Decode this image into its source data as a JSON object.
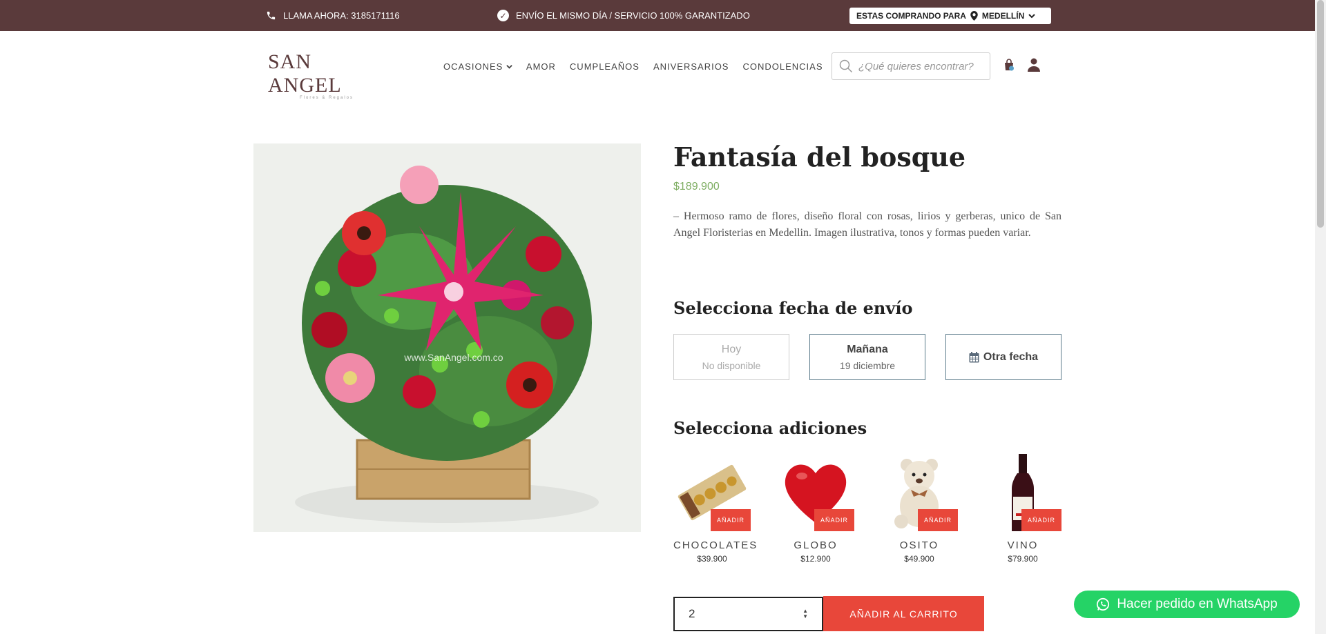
{
  "topbar": {
    "phone": "LLAMA AHORA: 3185171116",
    "guarantee": "ENVÍO EL MISMO DÍA / SERVICIO 100% GARANTIZADO",
    "buying_for": "ESTAS COMPRANDO PARA",
    "city": "MEDELLÍN"
  },
  "header": {
    "logo": "SAN ANGEL",
    "logo_sub": "Flores & Regalos",
    "nav": [
      "OCASIONES",
      "AMOR",
      "CUMPLEAÑOS",
      "ANIVERSARIOS",
      "CONDOLENCIAS"
    ],
    "search_placeholder": "¿Qué quieres encontrar?",
    "cart_count": "0"
  },
  "product": {
    "title": "Fantasía del bosque",
    "price": "$189.900",
    "description": "– Hermoso ramo de flores, diseño floral con rosas, lirios y gerberas, unico de San Angel Floristerias en Medellin. Imagen ilustrativa, tonos y formas pueden variar.",
    "watermark": "www.SanAngel.com.co"
  },
  "dates": {
    "title": "Selecciona fecha de envío",
    "options": [
      {
        "main": "Hoy",
        "sub": "No disponible"
      },
      {
        "main": "Mañana",
        "sub": "19 diciembre"
      },
      {
        "main": "Otra fecha",
        "sub": ""
      }
    ]
  },
  "addons": {
    "title": "Selecciona adiciones",
    "add_label": "AÑADIR",
    "items": [
      {
        "name": "CHOCOLATES",
        "price": "$39.900"
      },
      {
        "name": "GLOBO",
        "price": "$12.900"
      },
      {
        "name": "OSITO",
        "price": "$49.900"
      },
      {
        "name": "VINO",
        "price": "$79.900"
      }
    ]
  },
  "cart": {
    "quantity": "2",
    "add_to_cart": "AÑADIR AL CARRITO"
  },
  "whatsapp": "Hacer pedido en WhatsApp",
  "colors": {
    "topbar": "#5a3a3b",
    "accent": "#e8473a",
    "price": "#7fae63",
    "whatsapp": "#25d366"
  }
}
